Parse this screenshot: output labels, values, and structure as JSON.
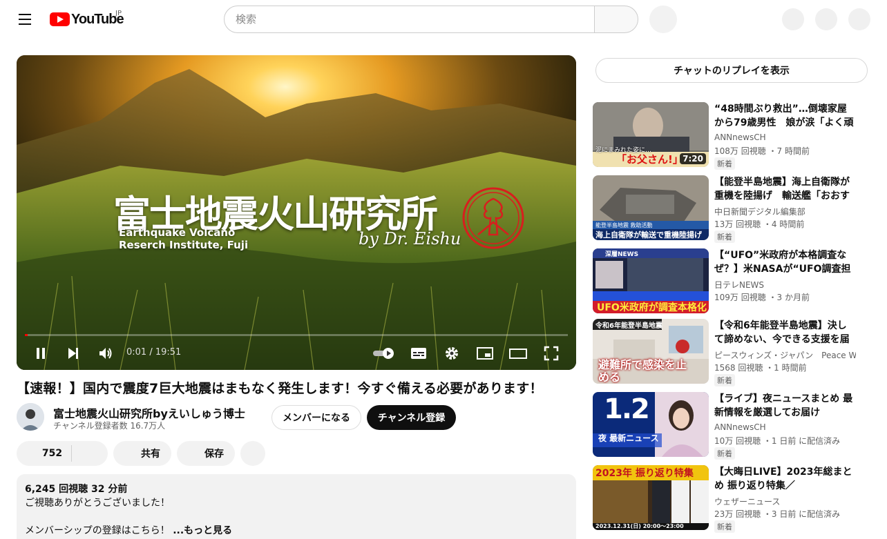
{
  "header": {
    "logo_text": "YouTube",
    "region": "JP",
    "search_placeholder": "検索"
  },
  "player": {
    "overlay_title_jp": "富士地震火山研究所",
    "overlay_title_en_line1": "Earthquake Volcano",
    "overlay_title_en_line2": "Reserch Institute, Fuji",
    "overlay_byline": "by Dr. Eishu",
    "current_time": "0:01",
    "duration": "19:51",
    "progress_fraction": 0.001
  },
  "video": {
    "title": "【速報！】国内で震度7巨大地震はまもなく発生します！今すぐ備える必要があります！",
    "channel_name": "富士地震火山研究所byえいしゅう博士",
    "subscriber_count": "チャンネル登録者数 16.7万人",
    "member_button": "メンバーになる",
    "subscribe_button": "チャンネル登録",
    "like_count": "752",
    "share_label": "共有",
    "save_label": "保存"
  },
  "description": {
    "stats": "6,245 回視聴  32 分前",
    "line1": "ご視聴ありがとうございました！",
    "line2": "メンバーシップの登録はこちら！",
    "more": "...もっと見る"
  },
  "sidebar": {
    "chat_replay_button": "チャットのリプレイを表示",
    "recommendations": [
      {
        "title": "“48時間ぶり救出”…倒壊家屋から79歳男性　娘が涙「よく頑張った」",
        "channel": "ANNnewsCH",
        "meta": "108万 回視聴 ・7 時間前",
        "badge": "新着",
        "duration": "7:20",
        "thumb_caption_top": "泥にまみれた姿に…",
        "thumb_caption": "「お父さん!」"
      },
      {
        "title": "【能登半島地震】海上自衛隊が重機を陸揚げ　輸送艦「おおすみ」",
        "channel": "中日新聞デジタル編集部",
        "meta": "13万 回視聴 ・4 時間前",
        "badge": "新着",
        "thumb_caption_top": "能登半島地震 救助活動",
        "thumb_caption": "海上自衛隊が輸送で重機陸揚げ"
      },
      {
        "title": "【“UFO”米政府が本格調査なぜ？】米NASAが“UFO調査担当”新設",
        "channel": "日テレNEWS",
        "meta": "109万 回視聴 ・3 か月前",
        "thumb_caption_top": "深層NEWS",
        "thumb_caption": "UFO米政府が調査本格化"
      },
      {
        "title": "【令和6年能登半島地震】決して諦めない、今できる支援を届ける",
        "channel": "ピースウィンズ・ジャパン　Peace Winds Japan",
        "meta": "1568 回視聴 ・1 時間前",
        "badge": "新着",
        "thumb_caption_top": "令和6年能登半島地震",
        "thumb_caption": "避難所で感染を止める"
      },
      {
        "title": "【ライブ】夜ニュースまとめ 最新情報を厳選してお届け",
        "channel": "ANNnewsCH",
        "meta": "10万 回視聴 ・1 日前 に配信済み",
        "badge": "新着",
        "thumb_caption_top": "1.2",
        "thumb_caption": "夜 最新ニュース"
      },
      {
        "title": "【大晦日LIVE】2023年総まとめ 振り返り特集／",
        "channel": "ウェザーニュース",
        "meta": "23万 回視聴 ・3 日前 に配信済み",
        "badge": "新着",
        "thumb_caption_top": "2023年 振り返り特集",
        "thumb_caption": "2023.12.31(日) 20:00〜23:00"
      }
    ]
  }
}
